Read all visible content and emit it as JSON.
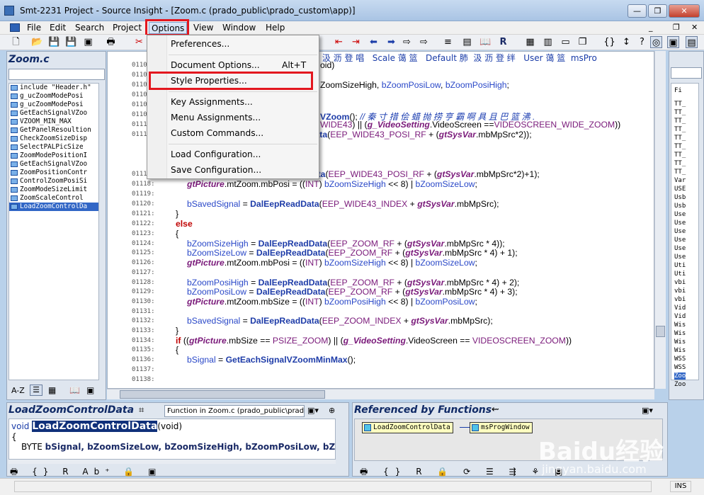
{
  "window": {
    "title": "Smt-2231 Project - Source Insight - [Zoom.c (prado_public\\prado_custom\\app)]",
    "minimize": "—",
    "restore": "❐",
    "close": "✕"
  },
  "menubar": [
    "File",
    "Edit",
    "Search",
    "Project",
    "Options",
    "View",
    "Window",
    "Help"
  ],
  "options_menu": {
    "items": [
      {
        "label": "Preferences...",
        "shortcut": ""
      },
      {
        "label": "Document Options...",
        "shortcut": "Alt+T"
      },
      {
        "label": "Style Properties...",
        "shortcut": ""
      },
      {
        "label": "Key Assignments...",
        "shortcut": ""
      },
      {
        "label": "Menu Assignments...",
        "shortcut": ""
      },
      {
        "label": "Custom Commands...",
        "shortcut": ""
      },
      {
        "label": "Load Configuration...",
        "shortcut": ""
      },
      {
        "label": "Save Configuration...",
        "shortcut": ""
      }
    ],
    "highlighted": "Style Properties..."
  },
  "symbol_panel": {
    "title": "Zoom.c",
    "symbols": [
      "include \"Header.h\"",
      "g_ucZoomModePosi",
      "g_ucZoomModePosi",
      "GetEachSignalVZoo",
      "VZOOM_MIN_MAX",
      "GetPanelResoultion",
      "CheckZoomSizeDisp",
      "SelectPALPicSize",
      "ZoomModePositionI",
      "GetEachSignalVZoo",
      "ZoomPositionContr",
      "ControlZoomPosiSi",
      "ZoomModeSizeLimit",
      "ZoomScaleControl",
      "LoadZoomControlDa"
    ],
    "selected": "LoadZoomControlDa",
    "bottom_label": "A-Z"
  },
  "editor": {
    "header_row": "篮 汲 沥 登 唱   Scale 蔼 篮   Default 肺  汲 沥 登 绊   User 蔼 篮  msPro",
    "line_numbers": [
      "0110",
      "0110",
      "0110",
      "0110",
      "0110",
      "0110",
      "0111",
      "0111",
      "01117:",
      "01118:",
      "01119:",
      "01120:",
      "01121:",
      "01122:",
      "01123:",
      "01124:",
      "01125:",
      "01126:",
      "01127:",
      "01128:",
      "01129:",
      "01130:",
      "01131:",
      "01132:",
      "01133:",
      "01134:",
      "01135:",
      "01136:",
      "01137:",
      "01138:"
    ],
    "lines": [
      {
        "t": "oid)"
      },
      {
        "t": ""
      },
      {
        "t": "ZoomSizeHigh, bZoomPosiLow, bZoomPosiHigh;"
      },
      {
        "t": ""
      },
      {
        "t": ""
      },
      {
        "t": "VZoom(); // 秦 寸 措 侩 蜡 抛 捞 亨 霸 啊 具 且 巴 篮 沸 ."
      },
      {
        "t": "WIDE43) || (g_VideoSetting.VideoScreen ==VIDEOSCREEN_WIDE_ZOOM))"
      },
      {
        "t": "bZoomSizeHigh = DalEepReadData(EEP_WIDE43_POSI_RF + (gtSysVar.mbMpSrc*2));"
      },
      {
        "t": "bZoomSizeLow = DalEepReadData(EEP_WIDE43_POSI_RF + (gtSysVar.mbMpSrc*2)+1);"
      },
      {
        "t": "gtPicture.mtZoom.mbPosi = ((INT) bZoomSizeHigh << 8) | bZoomSizeLow;"
      },
      {
        "t": ""
      },
      {
        "t": "bSavedSignal = DalEepReadData(EEP_WIDE43_INDEX + gtSysVar.mbMpSrc);"
      },
      {
        "t": "}"
      },
      {
        "t": "else"
      },
      {
        "t": "{"
      },
      {
        "t": "bZoomSizeHigh = DalEepReadData(EEP_ZOOM_RF + (gtSysVar.mbMpSrc * 4));"
      },
      {
        "t": "bZoomSizeLow = DalEepReadData(EEP_ZOOM_RF + (gtSysVar.mbMpSrc * 4) + 1);"
      },
      {
        "t": "gtPicture.mtZoom.mbPosi = ((INT) bZoomSizeHigh << 8) | bZoomSizeLow;"
      },
      {
        "t": ""
      },
      {
        "t": "bZoomPosiHigh = DalEepReadData(EEP_ZOOM_RF + (gtSysVar.mbMpSrc * 4) + 2);"
      },
      {
        "t": "bZoomPosiLow = DalEepReadData(EEP_ZOOM_RF + (gtSysVar.mbMpSrc * 4) + 3);"
      },
      {
        "t": "gtPicture.mtZoom.mbSize = ((INT) bZoomPosiHigh << 8) | bZoomPosiLow;"
      },
      {
        "t": ""
      },
      {
        "t": "bSavedSignal = DalEepReadData(EEP_ZOOM_INDEX + gtSysVar.mbMpSrc);"
      },
      {
        "t": "}"
      },
      {
        "t": "if ((gtPicture.mbSize == PSIZE_ZOOM) || (g_VideoSetting.VideoScreen == VIDEOSCREEN_ZOOM))"
      },
      {
        "t": "{"
      },
      {
        "t": "bSignal = GetEachSignalVZoomMinMax();"
      },
      {
        "t": ""
      }
    ]
  },
  "right_panel": {
    "header": "Fi",
    "items": [
      "TT_",
      "TT_",
      "TT_",
      "TT_",
      "TT_",
      "TT_",
      "TT_",
      "TT_",
      "TT_",
      "Var",
      "USE",
      "Usb",
      "Usb",
      "Use",
      "Use",
      "Use",
      "Use",
      "Use",
      "Use",
      "Uti",
      "Uti",
      "vbi",
      "vbi",
      "vbi",
      "Vid",
      "Vid",
      "Wis",
      "Wis",
      "Wis",
      "Wis",
      "WSS",
      "WSS",
      "Zoo",
      "Zoo"
    ]
  },
  "context_panel": {
    "title": "LoadZoomControlData",
    "subtitle": "Function in Zoom.c (prado_public\\prado",
    "code_line1_kw": "void",
    "code_line1_fn": "LoadZoomControlData",
    "code_line1_rest": "(void)",
    "code_line2": "{",
    "code_line3_kw": "BYTE",
    "code_line3_rest": "bSignal, bZoomSizeLow, bZoomSizeHigh, bZoomPosiLow, bZoor"
  },
  "ref_panel": {
    "title": "Referenced by Functions",
    "node_from": "LoadZoomControlData",
    "node_to": "msProgWindow"
  },
  "statusbar": {
    "mode": "INS"
  },
  "watermark": {
    "brand": "Baidu经验",
    "url": "jingyan.baidu.com"
  }
}
